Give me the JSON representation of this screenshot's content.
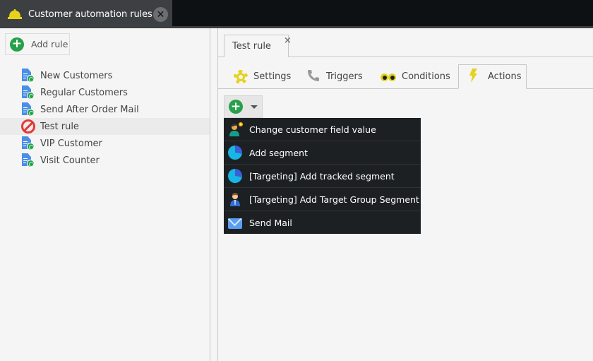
{
  "window_tab": {
    "title": "Customer automation rules",
    "icon": "bell-icon",
    "close_icon": "close-icon"
  },
  "left_panel": {
    "add_button_label": "Add rule",
    "rules": [
      {
        "label": "New Customers",
        "icon": "rule-document-icon",
        "selected": false
      },
      {
        "label": "Regular Customers",
        "icon": "rule-document-icon",
        "selected": false
      },
      {
        "label": "Send After Order Mail",
        "icon": "rule-document-icon",
        "selected": false
      },
      {
        "label": "Test rule",
        "icon": "disabled-icon",
        "selected": true
      },
      {
        "label": "VIP Customer",
        "icon": "rule-document-icon",
        "selected": false
      },
      {
        "label": "Visit Counter",
        "icon": "rule-document-icon",
        "selected": false
      }
    ]
  },
  "editor": {
    "doc_tab_label": "Test rule",
    "doc_tab_close": "×",
    "tabs": [
      {
        "label": "Settings",
        "icon": "gear-icon",
        "active": false
      },
      {
        "label": "Triggers",
        "icon": "phone-icon",
        "active": false
      },
      {
        "label": "Conditions",
        "icon": "binoculars-icon",
        "active": false
      },
      {
        "label": "Actions",
        "icon": "lightning-icon",
        "active": true
      }
    ],
    "add_action_button": "add-icon",
    "action_menu": [
      {
        "label": "Change customer field value",
        "icon": "user-edit-icon"
      },
      {
        "label": "Add segment",
        "icon": "pie-chart-icon"
      },
      {
        "label": "[Targeting] Add tracked segment",
        "icon": "pie-chart-icon"
      },
      {
        "label": "[Targeting] Add Target Group Segment",
        "icon": "business-user-icon"
      },
      {
        "label": "Send Mail",
        "icon": "mail-icon"
      }
    ]
  },
  "colors": {
    "accent_green": "#27a04a",
    "icon_yellow": "#e6d21c",
    "menu_bg": "#1d2023",
    "topbar_bg": "#0d1114"
  }
}
